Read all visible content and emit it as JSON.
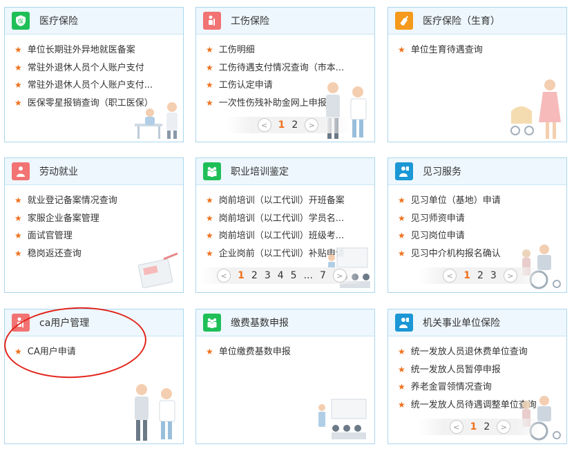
{
  "cards": [
    {
      "title": "医疗保险",
      "icon": "insurance-shield-icon",
      "items": [
        "单位长期驻外异地就医备案",
        "常驻外退休人员个人账户支付",
        "常驻外退休人员个人账户支付...",
        "医保零星报销查询（职工医保）"
      ]
    },
    {
      "title": "工伤保险",
      "icon": "injured-person-icon",
      "items": [
        "工伤明细",
        "工伤待遇支付情况查询（市本...",
        "工伤认定申请",
        "一次性伤残补助金网上申报"
      ],
      "pager": {
        "pages": [
          "1",
          "2"
        ],
        "active": "1"
      }
    },
    {
      "title": "医疗保险（生育）",
      "icon": "baby-bottle-icon",
      "items": [
        "单位生育待遇查询"
      ]
    },
    {
      "title": "劳动就业",
      "icon": "worker-icon",
      "items": [
        "就业登记备案情况查询",
        "家服企业备案管理",
        "面试官管理",
        "稳岗返还查询"
      ]
    },
    {
      "title": "职业培训鉴定",
      "icon": "training-group-icon",
      "items": [
        "岗前培训（以工代训）开班备案",
        "岗前培训（以工代训）学员名...",
        "岗前培训（以工代训）班级考...",
        "企业岗前（以工代训）补贴申请"
      ],
      "pager": {
        "pages": [
          "1",
          "2",
          "3",
          "4",
          "5",
          "...",
          "7"
        ],
        "active": "1"
      }
    },
    {
      "title": "见习服务",
      "icon": "intern-person-icon",
      "items": [
        "见习单位（基地）申请",
        "见习师资申请",
        "见习岗位申请",
        "见习中介机构报名确认"
      ],
      "pager": {
        "pages": [
          "1",
          "2",
          "3"
        ],
        "active": "1"
      }
    },
    {
      "title": "ca用户管理",
      "icon": "ca-user-icon",
      "items": [
        "CA用户申请"
      ]
    },
    {
      "title": "缴费基数申报",
      "icon": "group-payment-icon",
      "items": [
        "单位缴费基数申报"
      ]
    },
    {
      "title": "机关事业单位保险",
      "icon": "office-person-icon",
      "items": [
        "统一发放人员退休费单位查询",
        "统一发放人员暂停申报",
        "养老金冒领情况查询",
        "统一发放人员待遇调整单位查询"
      ],
      "pager": {
        "pages": [
          "1",
          "2"
        ],
        "active": "1"
      }
    }
  ],
  "colors": {
    "accent_star": "#f0701a",
    "card_border": "#a9d6ee",
    "header_bg": "#eef7fd",
    "highlight_ellipse": "#e2231a"
  }
}
